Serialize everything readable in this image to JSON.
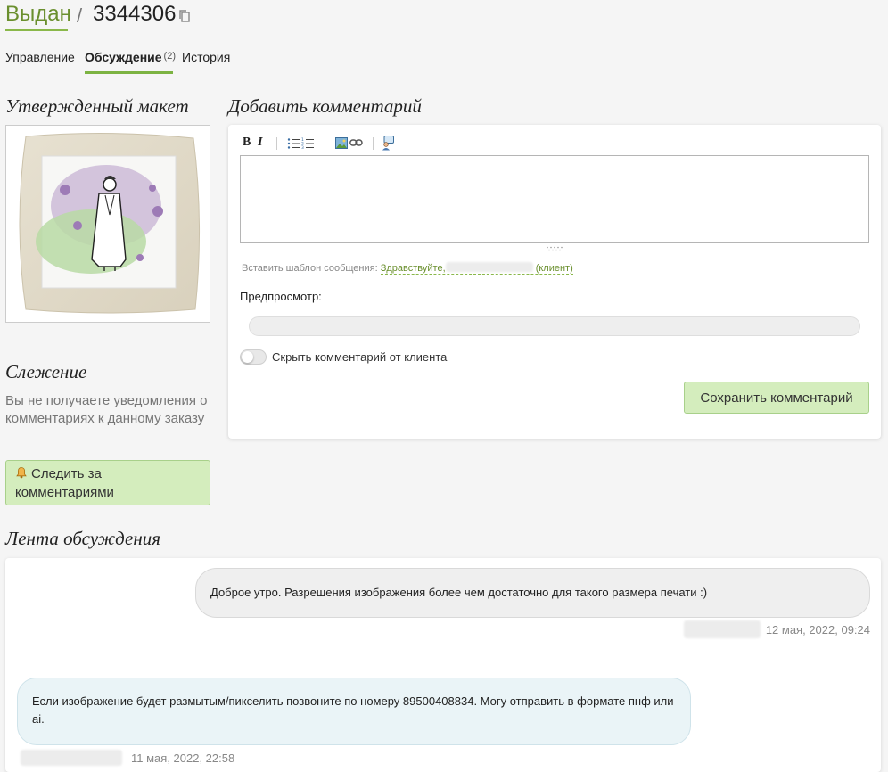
{
  "header": {
    "status": "Выдан",
    "separator": "/",
    "order_number": "3344306"
  },
  "tabs": [
    {
      "label": "Управление"
    },
    {
      "label": "Обсуждение",
      "badge": "(2)",
      "active": true
    },
    {
      "label": "История"
    }
  ],
  "mockup": {
    "heading": "Утвержденный макет"
  },
  "tracking": {
    "heading": "Слежение",
    "text": "Вы не получаете уведомления о комментариях к данному заказу",
    "button_label": "Следить за комментариями"
  },
  "comment_form": {
    "heading": "Добавить комментарий",
    "toolbar": {
      "bold": "B",
      "italic": "I",
      "icons": [
        "bulleted-list-icon",
        "numbered-list-icon",
        "image-icon",
        "link-icon",
        "template-icon"
      ]
    },
    "template_prefix": "Вставить шаблон сообщения:",
    "template_greeting": "Здравствуйте,",
    "template_client": "(клиент)",
    "preview_label": "Предпросмотр:",
    "hide_label": "Скрыть комментарий от клиента",
    "hide_enabled": false,
    "save_label": "Сохранить комментарий"
  },
  "feed": {
    "heading": "Лента обсуждения",
    "messages": [
      {
        "text": "Доброе утро. Разрешения изображения более чем достаточно для такого размера печати :)",
        "date": "12 мая, 2022, 09:24"
      },
      {
        "text": "Если изображение будет размытым/пикселить позвоните по номеру 89500408834. Могу отправить в формате пнф или ai.",
        "date": "11 мая, 2022, 22:58"
      }
    ]
  },
  "colors": {
    "accent_green": "#7cb342",
    "status_green": "#6a8f2e",
    "button_green": "#d4edbd",
    "client_bubble": "#eaf4f7",
    "staff_bubble": "#efefef"
  }
}
